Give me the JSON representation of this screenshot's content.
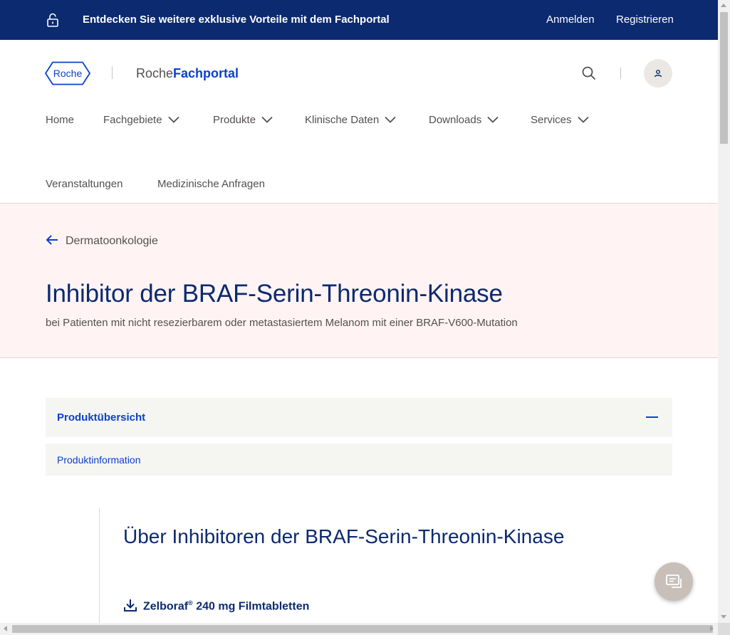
{
  "topbar": {
    "promo_text": "Entdecken Sie weitere exklusive Vorteile mit dem Fachportal",
    "login_label": "Anmelden",
    "register_label": "Registrieren",
    "icon": "unlock-icon"
  },
  "header": {
    "logo_text": "Roche",
    "brand_prefix": "Roche",
    "brand_suffix": "Fachportal",
    "search_icon": "search-icon",
    "user_icon": "user-icon"
  },
  "nav": {
    "items": [
      {
        "label": "Home"
      },
      {
        "label": "Fachgebiete"
      },
      {
        "label": "Produkte"
      },
      {
        "label": "Klinische Daten"
      },
      {
        "label": "Downloads"
      },
      {
        "label": "Services"
      },
      {
        "label": "Veranstaltungen"
      },
      {
        "label": "Medizinische Anfragen"
      }
    ]
  },
  "hero": {
    "back_label": "Dermatoonkologie",
    "title": "Inhibitor der BRAF-Serin-Threonin-Kinase",
    "subtitle": "bei Patienten mit nicht resezierbarem oder metastasiertem Melanom mit einer BRAF-V600-Mutation"
  },
  "accordion": {
    "header_label": "Produktübersicht",
    "items": [
      {
        "label": "Produktinformation"
      }
    ]
  },
  "content": {
    "section_title": "Über Inhibitoren der BRAF-Serin-Threonin-Kinase",
    "download_name": "Zelboraf",
    "download_reg": "®",
    "download_rest": " 240 mg Filmtabletten"
  },
  "colors": {
    "topbar_bg": "#0b2a6f",
    "accent_blue": "#0b41cd",
    "heading_navy": "#0b2a6f",
    "hero_bg": "#fff4f3",
    "accordion_bg": "#f5f5f2",
    "chat_button": "#c8bfb8"
  }
}
